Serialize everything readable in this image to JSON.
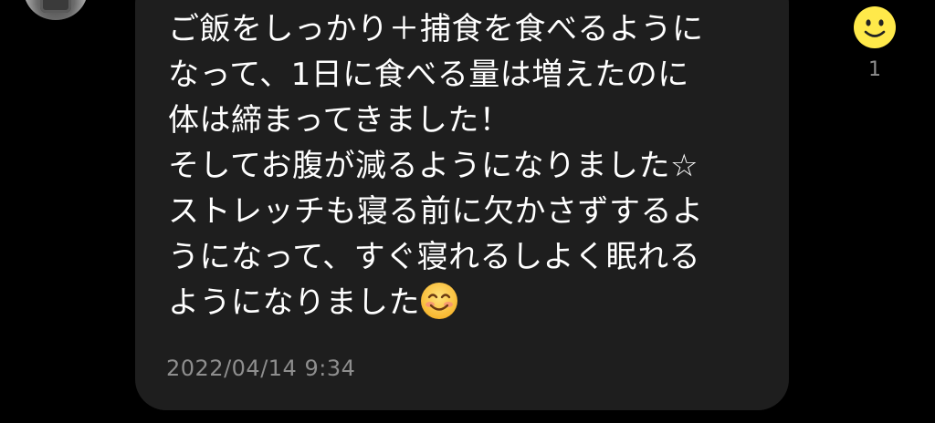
{
  "message": {
    "lines": [
      "ご飯をしっかり＋捕食を食べるように",
      "なって、1日に食べる量は増えたのに",
      "体は締まってきました！",
      "そしてお腹が減るようになりました☆",
      "ストレッチも寝る前に欠かさずするよ",
      "うになって、すぐ寝れるしよく眠れる",
      "ようになりました"
    ],
    "trailing_emoji": "smiling-face-emoji",
    "timestamp": "2022/04/14 9:34"
  },
  "reaction": {
    "icon": "smiley-reaction-icon",
    "count": "1",
    "color": "#FFE94A"
  },
  "colors": {
    "background": "#000000",
    "bubble": "#1E1E1E",
    "text": "#FFFFFF",
    "meta": "#8E8E8E"
  }
}
